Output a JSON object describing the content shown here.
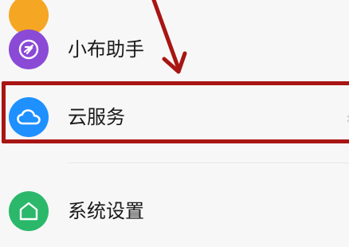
{
  "settings_list": {
    "items": [
      {
        "label": "",
        "icon": "partial-orange-icon",
        "color": "#f5a623"
      },
      {
        "label": "小布助手",
        "icon": "breeno-assistant-icon",
        "color": "#8a4ad6"
      },
      {
        "label": "云服务",
        "icon": "cloud-icon",
        "color": "#1e90ff"
      },
      {
        "label": "系统设置",
        "icon": "system-settings-icon",
        "color": "#2bb86a"
      }
    ]
  },
  "annotation": {
    "arrow_color": "#a81513",
    "highlight_color": "#a81513"
  }
}
